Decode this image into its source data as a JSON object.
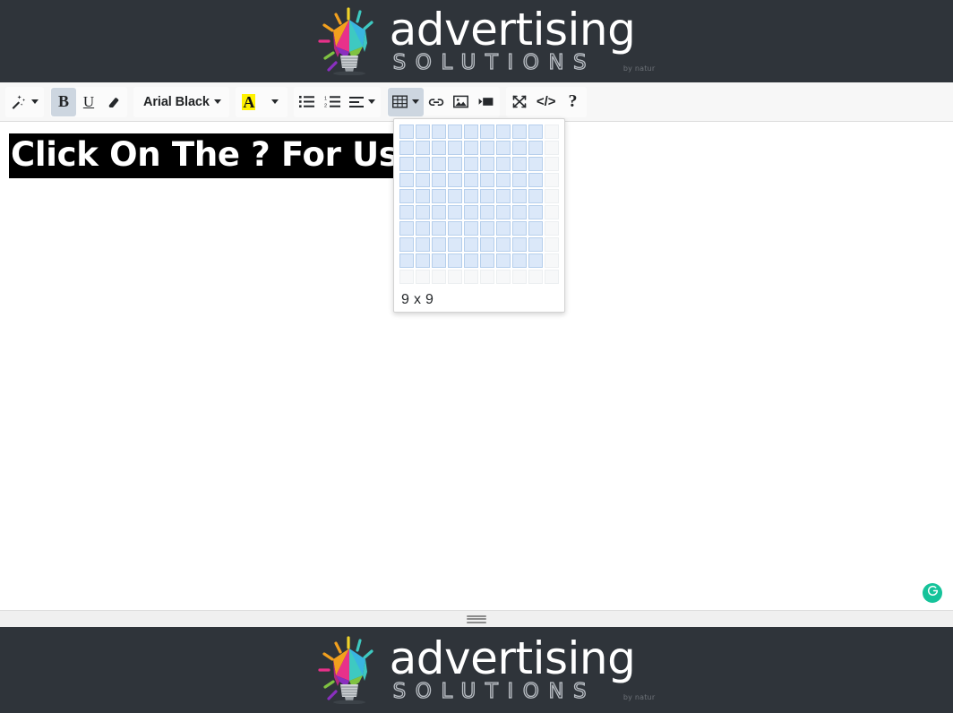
{
  "brand": {
    "word": "advertising",
    "sub": "SOLUTIONS",
    "tagline": "by natur",
    "bulb_icon": "lightbulb-icon",
    "bar_color": "#2f343a"
  },
  "toolbar": {
    "groups": [
      {
        "name": "magic-group",
        "buttons": [
          {
            "name": "magic-wand-button",
            "icon": "magic-wand-icon",
            "label": "",
            "caret": true,
            "active": false
          }
        ]
      },
      {
        "name": "text-style-group",
        "buttons": [
          {
            "name": "bold-button",
            "icon": "bold-icon",
            "label": "B",
            "caret": false,
            "active": true
          },
          {
            "name": "underline-button",
            "icon": "underline-icon",
            "label": "U",
            "caret": false,
            "active": false
          },
          {
            "name": "clear-formatting-button",
            "icon": "eraser-icon",
            "label": "",
            "caret": false,
            "active": false
          }
        ]
      },
      {
        "name": "font-family-group",
        "buttons": [
          {
            "name": "font-family-button",
            "icon": "font-family-icon",
            "label": "Arial Black",
            "caret": true,
            "active": false
          }
        ]
      },
      {
        "name": "text-color-group",
        "buttons": [
          {
            "name": "text-color-button",
            "icon": "text-color-icon",
            "label": "A",
            "caret": false,
            "active": false
          },
          {
            "name": "text-color-dropdown-button",
            "icon": "chevron-down-icon",
            "label": "",
            "caret": true,
            "active": false
          }
        ]
      },
      {
        "name": "paragraph-group",
        "buttons": [
          {
            "name": "unordered-list-button",
            "icon": "bullet-list-icon",
            "label": "",
            "caret": false,
            "active": false
          },
          {
            "name": "ordered-list-button",
            "icon": "numbered-list-icon",
            "label": "",
            "caret": false,
            "active": false
          },
          {
            "name": "align-button",
            "icon": "align-left-icon",
            "label": "",
            "caret": true,
            "active": false
          }
        ]
      },
      {
        "name": "insert-group",
        "buttons": [
          {
            "name": "insert-table-button",
            "icon": "table-icon",
            "label": "",
            "caret": true,
            "active": true
          },
          {
            "name": "insert-link-button",
            "icon": "link-icon",
            "label": "",
            "caret": false,
            "active": false
          },
          {
            "name": "insert-image-button",
            "icon": "image-icon",
            "label": "",
            "caret": false,
            "active": false
          },
          {
            "name": "insert-video-button",
            "icon": "video-icon",
            "label": "",
            "caret": false,
            "active": false
          }
        ]
      },
      {
        "name": "tools-group",
        "buttons": [
          {
            "name": "fullscreen-button",
            "icon": "fullscreen-icon",
            "label": "",
            "caret": false,
            "active": false
          },
          {
            "name": "code-view-button",
            "icon": "code-icon",
            "label": "</>",
            "caret": false,
            "active": false
          },
          {
            "name": "help-button",
            "icon": "question-mark-icon",
            "label": "?",
            "caret": false,
            "active": false
          }
        ]
      }
    ],
    "active_highlight_color": "#cdd6e0",
    "text_color_highlight": "#fff200"
  },
  "editor": {
    "heading_text": "Click On The ? For User Guide",
    "heading_background": "#000000",
    "heading_color": "#ffffff",
    "heading_font": "Arial Black"
  },
  "table_popup": {
    "name": "table-size-picker",
    "rows": 10,
    "cols": 10,
    "selected_rows": 9,
    "selected_cols": 9,
    "label": "9 x 9",
    "selected_cell_color": "#dbe8f9",
    "empty_cell_color": "#f7f8f9"
  },
  "grammarly": {
    "name": "grammarly-button",
    "icon": "grammarly-icon",
    "color": "#15c39a"
  },
  "statusbar": {
    "resize_handle": "resize-grip-icon"
  }
}
